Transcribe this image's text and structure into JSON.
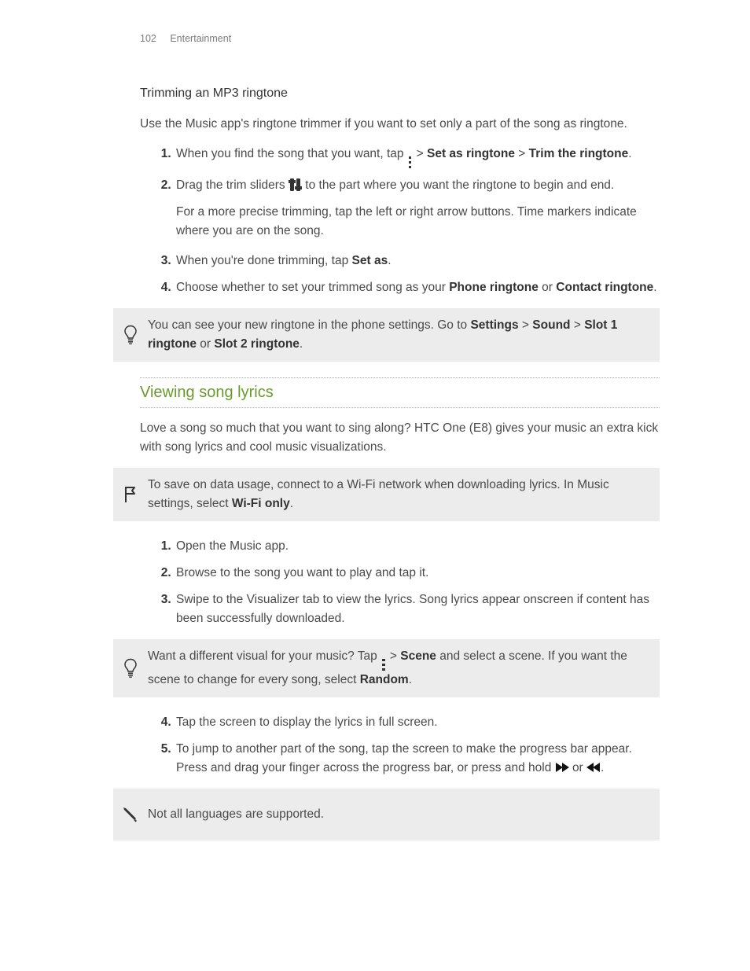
{
  "header": {
    "page_number": "102",
    "section": "Entertainment"
  },
  "trim": {
    "heading": "Trimming an MP3 ringtone",
    "intro": "Use the Music app's ringtone trimmer if you want to set only a part of the song as ringtone.",
    "step1_a": "When you find the song that you want, tap ",
    "step1_b": " > ",
    "step1_set": "Set as ringtone",
    "step1_c": " > ",
    "step1_trim": "Trim the ringtone",
    "step1_d": ".",
    "step2_a": "Drag the trim sliders ",
    "step2_b": " to the part where you want the ringtone to begin and end.",
    "step2_note": "For a more precise trimming, tap the left or right arrow buttons. Time markers indicate where you are on the song.",
    "step3_a": "When you're done trimming, tap ",
    "step3_setas": "Set as",
    "step3_b": ".",
    "step4_a": "Choose whether to set your trimmed song as your ",
    "step4_phone": "Phone ringtone",
    "step4_b": " or ",
    "step4_contact": "Contact ringtone",
    "step4_c": ".",
    "tip_a": "You can see your new ringtone in the phone settings. Go to ",
    "tip_settings": "Settings",
    "tip_gt1": " > ",
    "tip_sound": "Sound",
    "tip_gt2": " > ",
    "tip_slot1": "Slot 1 ringtone",
    "tip_or": " or ",
    "tip_slot2": "Slot 2 ringtone",
    "tip_end": "."
  },
  "lyrics": {
    "heading": "Viewing song lyrics",
    "intro": "Love a song so much that you want to sing along? HTC One (E8) gives your music an extra kick with song lyrics and cool music visualizations.",
    "flag_a": "To save on data usage, connect to a Wi-Fi network when downloading lyrics. In Music settings, select ",
    "flag_wifi": "Wi-Fi only",
    "flag_b": ".",
    "step1": "Open the Music app.",
    "step2": "Browse to the song you want to play and tap it.",
    "step3": "Swipe to the Visualizer tab to view the lyrics. Song lyrics appear onscreen if content has been successfully downloaded.",
    "tip2_a": "Want a different visual for your music? Tap ",
    "tip2_b": " > ",
    "tip2_scene": "Scene",
    "tip2_c": " and select a scene. If you want the scene to change for every song, select ",
    "tip2_random": "Random",
    "tip2_d": ".",
    "step4": "Tap the screen to display the lyrics in full screen.",
    "step5_a": "To jump to another part of the song, tap the screen to make the progress bar appear. Press and drag your finger across the progress bar, or press and hold ",
    "step5_b": " or ",
    "step5_c": ".",
    "note": "Not all languages are supported."
  }
}
